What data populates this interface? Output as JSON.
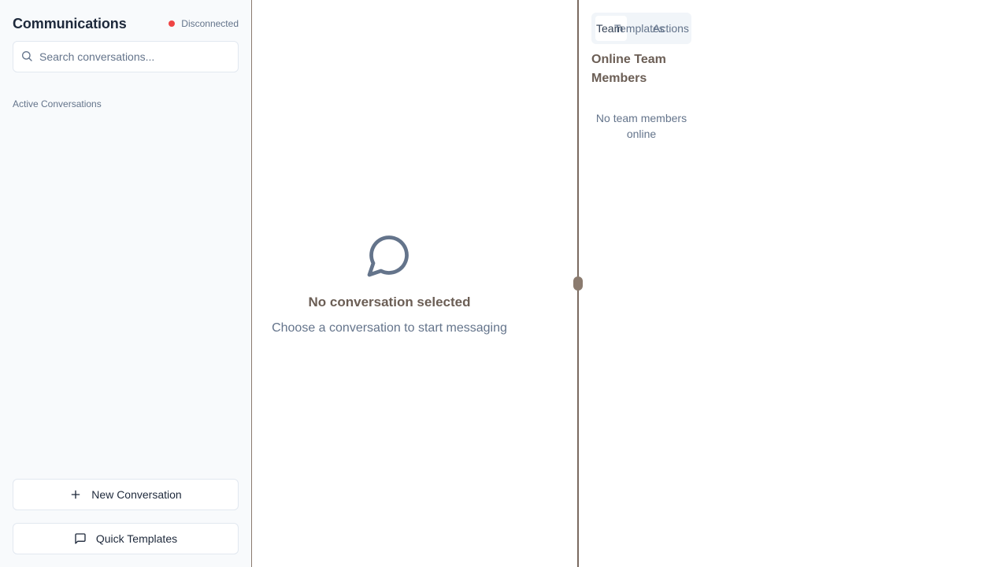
{
  "sidebar": {
    "title": "Communications",
    "status": {
      "label": "Disconnected",
      "color": "#ef4444"
    },
    "search": {
      "placeholder": "Search conversations...",
      "value": "",
      "icon": "search-icon"
    },
    "section_label": "Active Conversations",
    "buttons": {
      "new_conversation": {
        "label": "New Conversation",
        "icon": "plus-icon"
      },
      "quick_templates": {
        "label": "Quick Templates",
        "icon": "message-square-icon"
      }
    }
  },
  "main": {
    "empty_state": {
      "icon": "message-circle-icon",
      "title": "No conversation selected",
      "subtitle": "Choose a conversation to start messaging"
    }
  },
  "right_panel": {
    "tabs": [
      {
        "label": "Team",
        "active": true
      },
      {
        "label": "Templates",
        "active": false
      },
      {
        "label": "Actions",
        "active": false
      }
    ],
    "title": "Online Team Members",
    "empty_text": "No team members online"
  },
  "colors": {
    "accent_text": "#6b5e55",
    "divider": "#7a6a60",
    "muted": "#64748b"
  }
}
